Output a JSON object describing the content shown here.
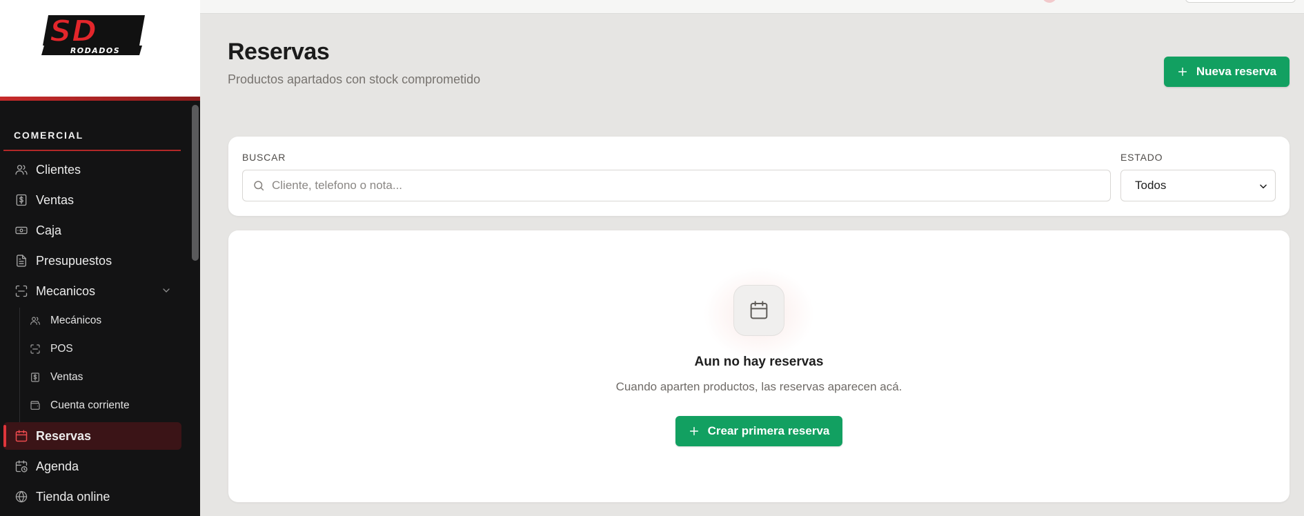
{
  "brand": {
    "logo_top": "SD",
    "logo_bottom": "RODADOS"
  },
  "sidebar": {
    "section_title": "COMERCIAL",
    "items": [
      {
        "label": "Clientes",
        "icon": "users-icon"
      },
      {
        "label": "Ventas",
        "icon": "dollar-icon"
      },
      {
        "label": "Caja",
        "icon": "cash-icon"
      },
      {
        "label": "Presupuestos",
        "icon": "document-icon"
      },
      {
        "label": "Mecanicos",
        "icon": "scan-icon",
        "expanded": true
      },
      {
        "label": "Reservas",
        "icon": "calendar-icon",
        "active": true
      },
      {
        "label": "Agenda",
        "icon": "calendar-clock-icon"
      },
      {
        "label": "Tienda online",
        "icon": "globe-icon"
      }
    ],
    "subitems": [
      {
        "label": "Mecánicos",
        "icon": "users-icon"
      },
      {
        "label": "POS",
        "icon": "scan-icon"
      },
      {
        "label": "Ventas",
        "icon": "dollar-icon"
      },
      {
        "label": "Cuenta corriente",
        "icon": "wallet-icon"
      }
    ]
  },
  "header": {
    "title": "Reservas",
    "subtitle": "Productos apartados con stock comprometido",
    "new_button": "Nueva reserva"
  },
  "filters": {
    "search_label": "BUSCAR",
    "search_placeholder": "Cliente, telefono o nota...",
    "search_value": "",
    "state_label": "ESTADO",
    "state_selected": "Todos"
  },
  "empty_state": {
    "icon": "calendar-icon",
    "title": "Aun no hay reservas",
    "text": "Cuando aparten productos, las reservas aparecen acá.",
    "button": "Crear primera reserva"
  },
  "colors": {
    "accent_green": "#12a061",
    "accent_red": "#e0353b",
    "sidebar_bg": "#131314",
    "page_bg": "#e6e5e3"
  }
}
